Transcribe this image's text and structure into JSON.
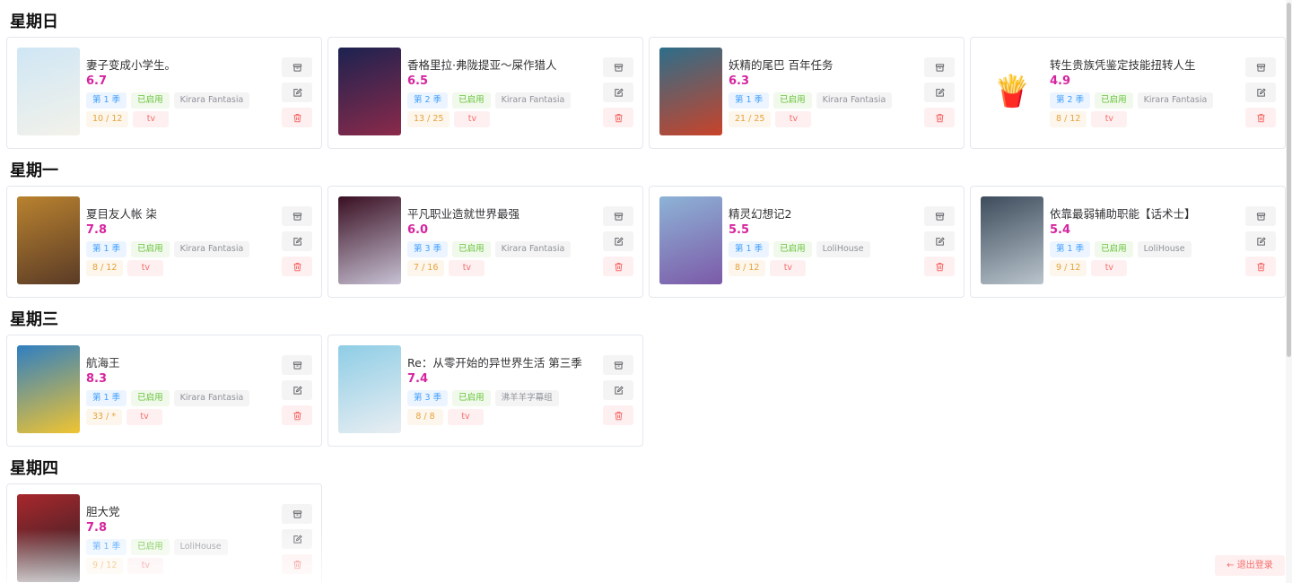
{
  "days": [
    {
      "title": "星期日",
      "items": [
        {
          "name": "妻子变成小学生。",
          "score": "6.7",
          "season": "第 1 季",
          "status": "已启用",
          "group": "Kirara Fantasia",
          "episodes": "10 / 12",
          "type": "tv",
          "cover_colors": [
            "#cfe6f5",
            "#f3f2ea"
          ],
          "cover_icon": ""
        },
        {
          "name": "香格里拉·弗陇提亚～屎作猎人",
          "score": "6.5",
          "season": "第 2 季",
          "status": "已启用",
          "group": "Kirara Fantasia",
          "episodes": "13 / 25",
          "type": "tv",
          "cover_colors": [
            "#1c2250",
            "#8b2a4a"
          ],
          "cover_icon": ""
        },
        {
          "name": "妖精的尾巴 百年任务",
          "score": "6.3",
          "season": "第 1 季",
          "status": "已启用",
          "group": "Kirara Fantasia",
          "episodes": "21 / 25",
          "type": "tv",
          "cover_colors": [
            "#2d6e8a",
            "#c9432a"
          ],
          "cover_icon": ""
        },
        {
          "name": "转生贵族凭鉴定技能扭转人生",
          "score": "4.9",
          "season": "第 2 季",
          "status": "已启用",
          "group": "Kirara Fantasia",
          "episodes": "8 / 12",
          "type": "tv",
          "cover_colors": [
            "#ffffff",
            "#ffffff"
          ],
          "cover_icon": "fries-icon"
        }
      ]
    },
    {
      "title": "星期一",
      "items": [
        {
          "name": "夏目友人帐 柒",
          "score": "7.8",
          "season": "第 1 季",
          "status": "已启用",
          "group": "Kirara Fantasia",
          "episodes": "8 / 12",
          "type": "tv",
          "cover_colors": [
            "#b9822f",
            "#5a3b26"
          ],
          "cover_icon": ""
        },
        {
          "name": "平凡职业造就世界最强",
          "score": "6.0",
          "season": "第 3 季",
          "status": "已启用",
          "group": "Kirara Fantasia",
          "episodes": "7 / 16",
          "type": "tv",
          "cover_colors": [
            "#3a0f22",
            "#c7c1d4"
          ],
          "cover_icon": ""
        },
        {
          "name": "精灵幻想记2",
          "score": "5.5",
          "season": "第 1 季",
          "status": "已启用",
          "group": "LoliHouse",
          "episodes": "8 / 12",
          "type": "tv",
          "cover_colors": [
            "#8db3d6",
            "#7c5aa8"
          ],
          "cover_icon": ""
        },
        {
          "name": "依靠最弱辅助职能【话术士】",
          "score": "5.4",
          "season": "第 1 季",
          "status": "已启用",
          "group": "LoliHouse",
          "episodes": "9 / 12",
          "type": "tv",
          "cover_colors": [
            "#3d4c5c",
            "#b9c4cc"
          ],
          "cover_icon": ""
        }
      ]
    },
    {
      "title": "星期三",
      "items": [
        {
          "name": "航海王",
          "score": "8.3",
          "season": "第 1 季",
          "status": "已启用",
          "group": "Kirara Fantasia",
          "episodes": "33 / *",
          "type": "tv",
          "cover_colors": [
            "#2f7fc2",
            "#f0c431"
          ],
          "cover_icon": ""
        },
        {
          "name": "Re：从零开始的异世界生活 第三季",
          "score": "7.4",
          "season": "第 3 季",
          "status": "已启用",
          "group": "沸羊羊字幕组",
          "episodes": "8 / 8",
          "type": "tv",
          "cover_colors": [
            "#8ecde6",
            "#e9eef2"
          ],
          "cover_icon": ""
        }
      ]
    },
    {
      "title": "星期四",
      "items": [
        {
          "name": "胆大党",
          "score": "7.8",
          "season": "第 1 季",
          "status": "已启用",
          "group": "LoliHouse",
          "episodes": "9 / 12",
          "type": "tv",
          "cover_colors": [
            "#a8272c",
            "#222026"
          ],
          "cover_icon": ""
        }
      ]
    }
  ],
  "logout_label": "退出登录"
}
